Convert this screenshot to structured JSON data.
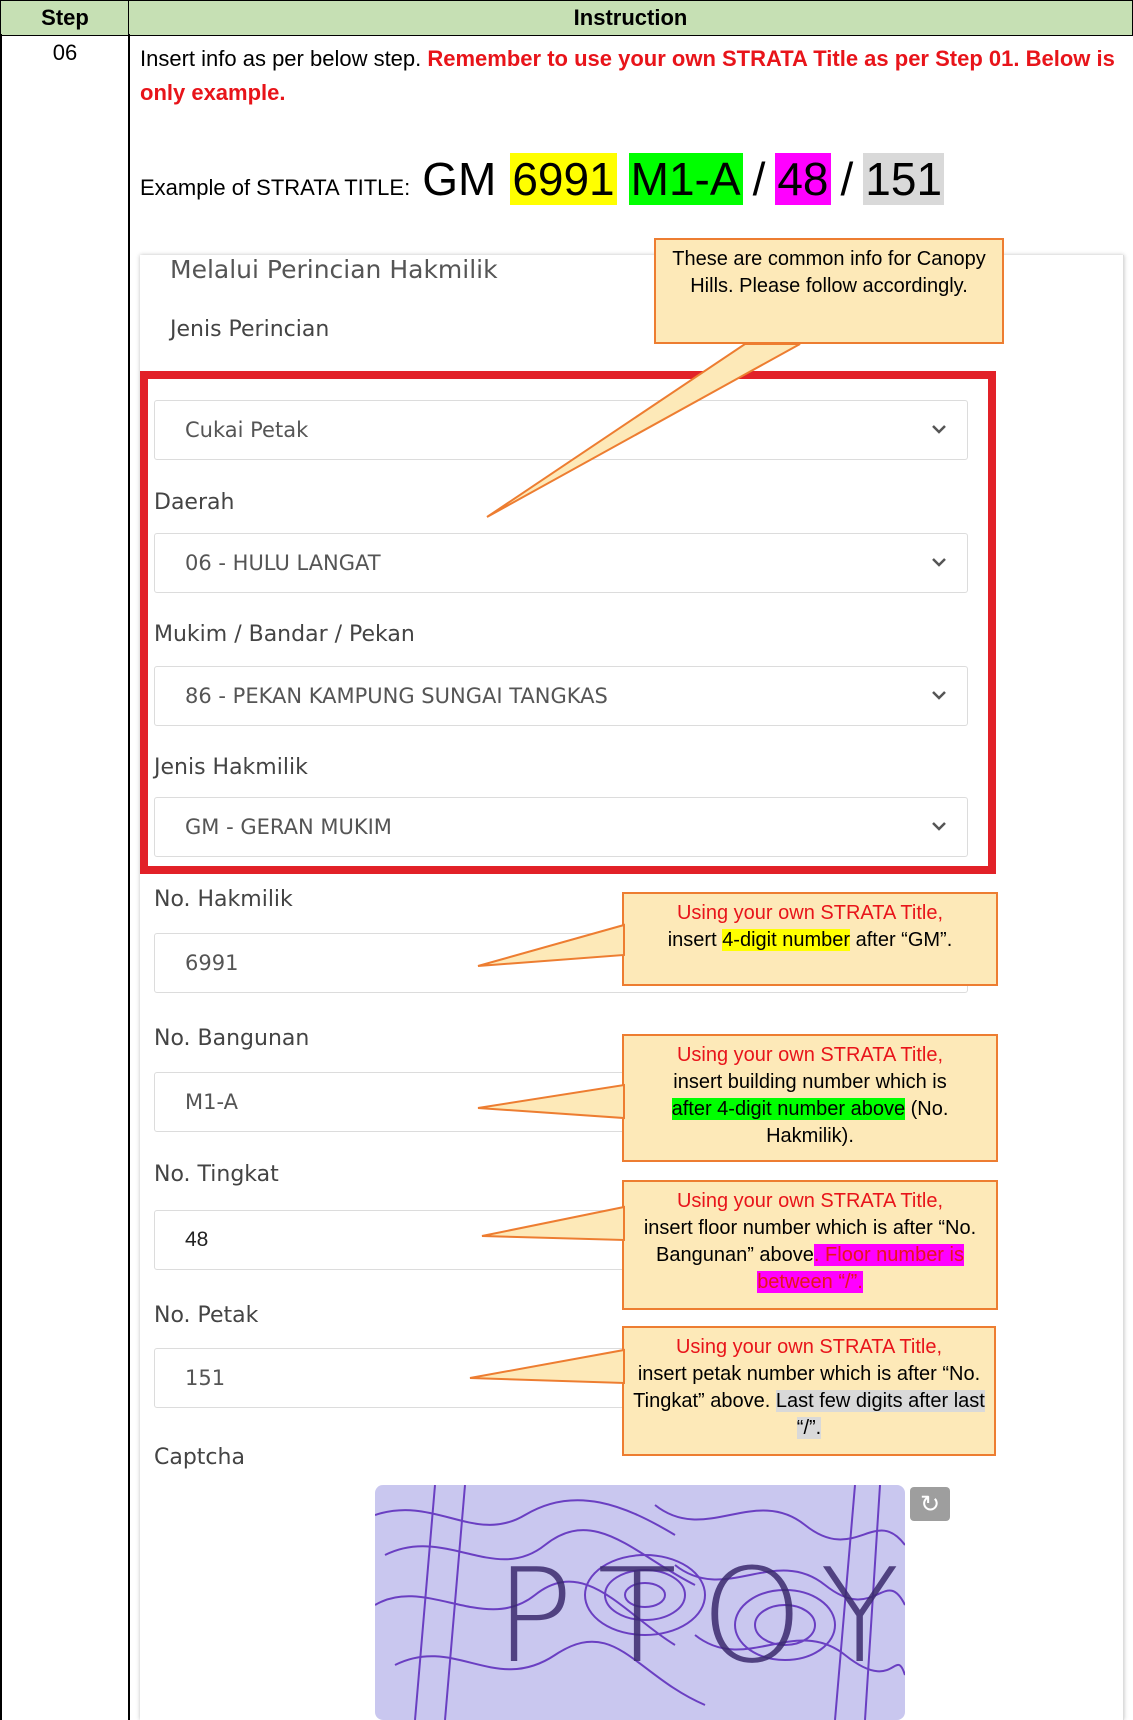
{
  "table": {
    "header_step": "Step",
    "header_instruction": "Instruction",
    "step_number": "06"
  },
  "instruction": {
    "line_prefix": "Insert info as per below step. ",
    "line_emphasis": "Remember to use your own STRATA Title as per Step 01. Below is only example.",
    "example_label": "Example of STRATA TITLE:",
    "example_parts": {
      "prefix": "GM",
      "hakmilik": "6991",
      "bangunan": "M1-A",
      "slash": "/",
      "tingkat": "48",
      "petak": "151"
    }
  },
  "form": {
    "title": "Melalui Perincian Hakmilik",
    "jenis_perincian_label": "Jenis Perincian",
    "jenis_perincian_value": "Cukai Petak",
    "daerah_label": "Daerah",
    "daerah_value": "06 - HULU LANGAT",
    "mukim_label": "Mukim / Bandar / Pekan",
    "mukim_value": "86 - PEKAN KAMPUNG SUNGAI TANGKAS",
    "jenis_hakmilik_label": "Jenis Hakmilik",
    "jenis_hakmilik_value": "GM - GERAN MUKIM",
    "no_hakmilik_label": "No. Hakmilik",
    "no_hakmilik_value": "6991",
    "no_bangunan_label": "No. Bangunan",
    "no_bangunan_value": "M1-A",
    "no_tingkat_label": "No. Tingkat",
    "no_tingkat_value": "48",
    "no_petak_label": "No. Petak",
    "no_petak_value": "151",
    "captcha_label": "Captcha",
    "captcha_text": "PTOY",
    "refresh_icon": "refresh-icon"
  },
  "callouts": {
    "common": "These are common info for Canopy Hills. Please follow accordingly.",
    "hakmilik_red": "Using your own STRATA Title,",
    "hakmilik_a": "insert ",
    "hakmilik_hl": "4-digit number",
    "hakmilik_b": " after “GM”.",
    "bangunan_red": "Using your own STRATA Title,",
    "bangunan_a": "insert building number which is",
    "bangunan_hl": "after 4-digit number above",
    "bangunan_b": " (No. Hakmilik).",
    "tingkat_red": "Using your own STRATA Title,",
    "tingkat_a": "insert floor number which is after “No. Bangunan” above",
    "tingkat_hl": ". Floor number is between “/”.",
    "petak_red": "Using your own STRATA Title,",
    "petak_a": "insert petak number which is after “No. Tingkat” above. ",
    "petak_hl": "Last few digits after last “/”."
  },
  "colors": {
    "header_bg": "#c6e0b4",
    "emphasis_red": "#e8141a",
    "callout_bg": "#fde9b8",
    "callout_border": "#ed7d31",
    "box_red": "#e22128"
  }
}
